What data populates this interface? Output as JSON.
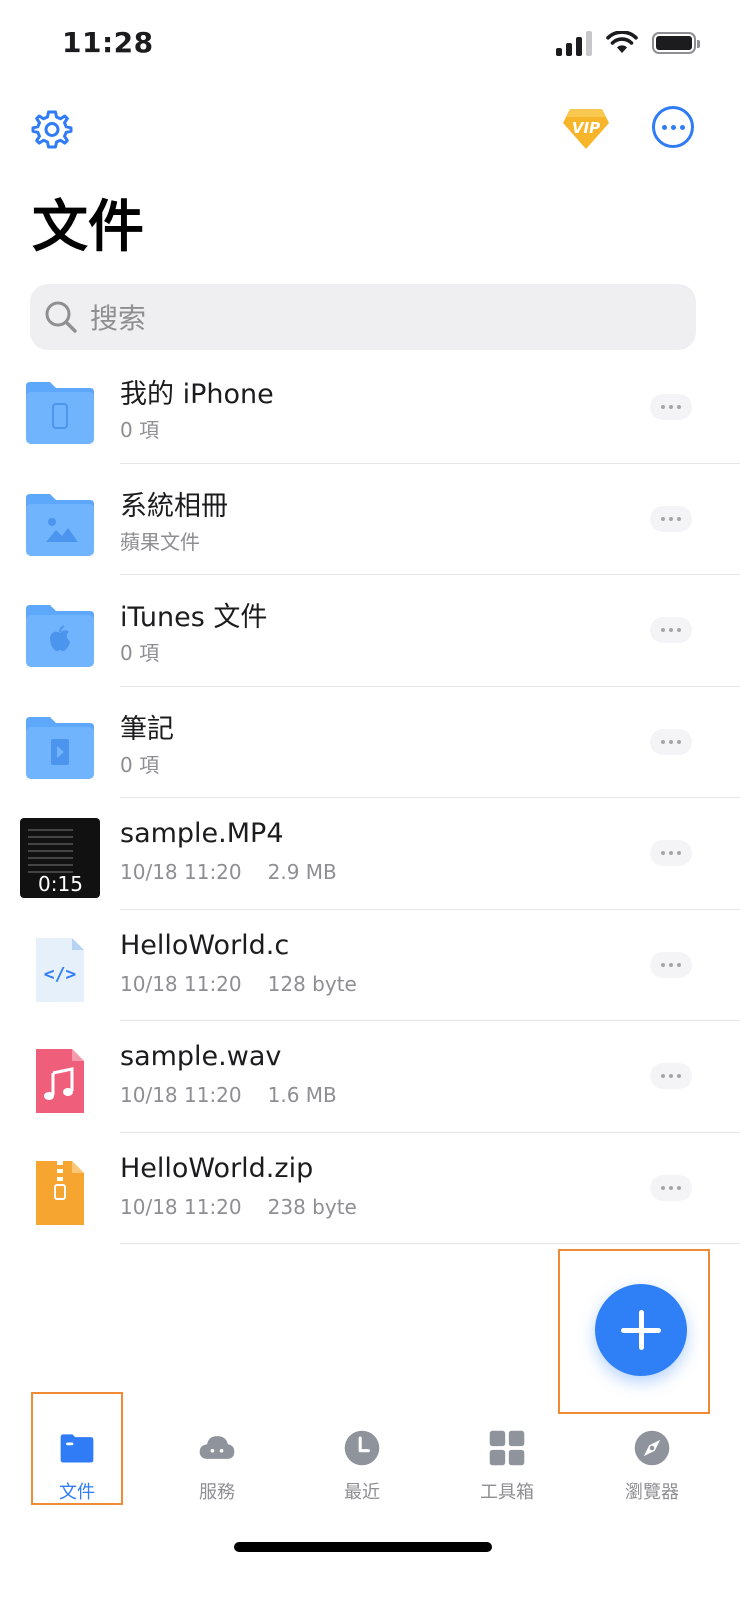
{
  "status_bar": {
    "time": "11:28"
  },
  "header": {
    "title": "文件",
    "vip_label": "VIP"
  },
  "search": {
    "placeholder": "搜索"
  },
  "items": [
    {
      "name": "我的 iPhone",
      "meta": "0 項",
      "size": "",
      "icon": "folder-phone-icon"
    },
    {
      "name": "系統相冊",
      "meta": "蘋果文件",
      "size": "",
      "icon": "folder-photo-icon"
    },
    {
      "name": "iTunes 文件",
      "meta": "0 項",
      "size": "",
      "icon": "folder-apple-icon"
    },
    {
      "name": "筆記",
      "meta": "0 項",
      "size": "",
      "icon": "folder-notes-icon"
    },
    {
      "name": "sample.MP4",
      "meta": "10/18 11:20",
      "size": "2.9 MB",
      "icon": "video-thumbnail",
      "duration": "0:15"
    },
    {
      "name": "HelloWorld.c",
      "meta": "10/18 11:20",
      "size": "128 byte",
      "icon": "code-file-icon"
    },
    {
      "name": "sample.wav",
      "meta": "10/18 11:20",
      "size": "1.6 MB",
      "icon": "music-file-icon"
    },
    {
      "name": "HelloWorld.zip",
      "meta": "10/18 11:20",
      "size": "238 byte",
      "icon": "zip-file-icon"
    }
  ],
  "tabs": [
    {
      "label": "文件",
      "icon": "folder-icon",
      "active": true
    },
    {
      "label": "服務",
      "icon": "cloud-icon",
      "active": false
    },
    {
      "label": "最近",
      "icon": "clock-icon",
      "active": false
    },
    {
      "label": "工具箱",
      "icon": "grid-icon",
      "active": false
    },
    {
      "label": "瀏覽器",
      "icon": "compass-icon",
      "active": false
    }
  ],
  "colors": {
    "accent": "#2f7cf6",
    "highlight": "#f08a34",
    "vip": "#f7b52a"
  }
}
